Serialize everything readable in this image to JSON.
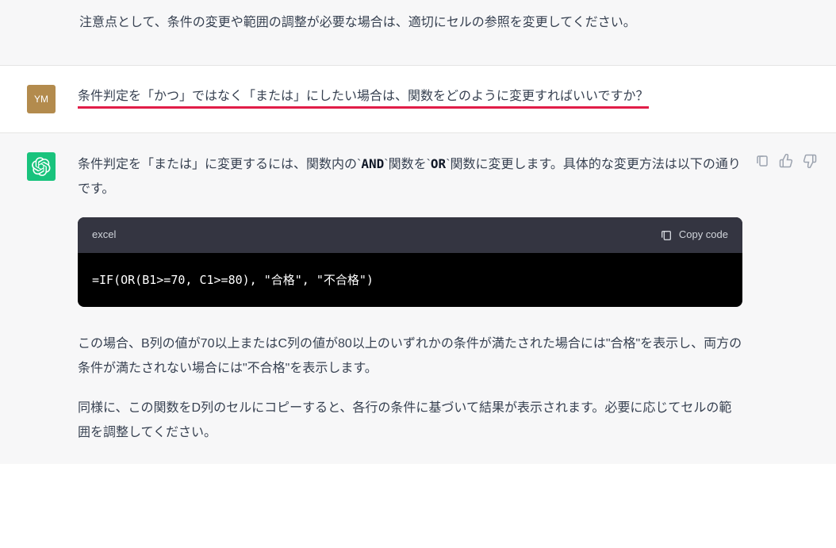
{
  "topContext": {
    "text": "注意点として、条件の変更や範囲の調整が必要な場合は、適切にセルの参照を変更してください。"
  },
  "userMessage": {
    "avatar": "YM",
    "text": "条件判定を「かつ」ではなく「または」にしたい場合は、関数をどのように変更すればいいですか？"
  },
  "assistantMessage": {
    "intro_pre": "条件判定を「または」に変更するには、関数内の",
    "intro_and": "AND",
    "intro_mid": "関数を",
    "intro_or": "OR",
    "intro_post": "関数に変更します。具体的な変更方法は以下の通りです。",
    "code": {
      "lang": "excel",
      "copyLabel": "Copy code",
      "content": "=IF(OR(B1>=70, C1>=80), \"合格\", \"不合格\")"
    },
    "para2": "この場合、B列の値が70以上またはC列の値が80以上のいずれかの条件が満たされた場合には\"合格\"を表示し、両方の条件が満たされない場合には\"不合格\"を表示します。",
    "para3": "同様に、この関数をD列のセルにコピーすると、各行の条件に基づいて結果が表示されます。必要に応じてセルの範囲を調整してください。"
  },
  "icons": {
    "copy": "copy-icon",
    "clipboard": "clipboard-icon",
    "thumbsUp": "thumbs-up-icon",
    "thumbsDown": "thumbs-down-icon"
  }
}
